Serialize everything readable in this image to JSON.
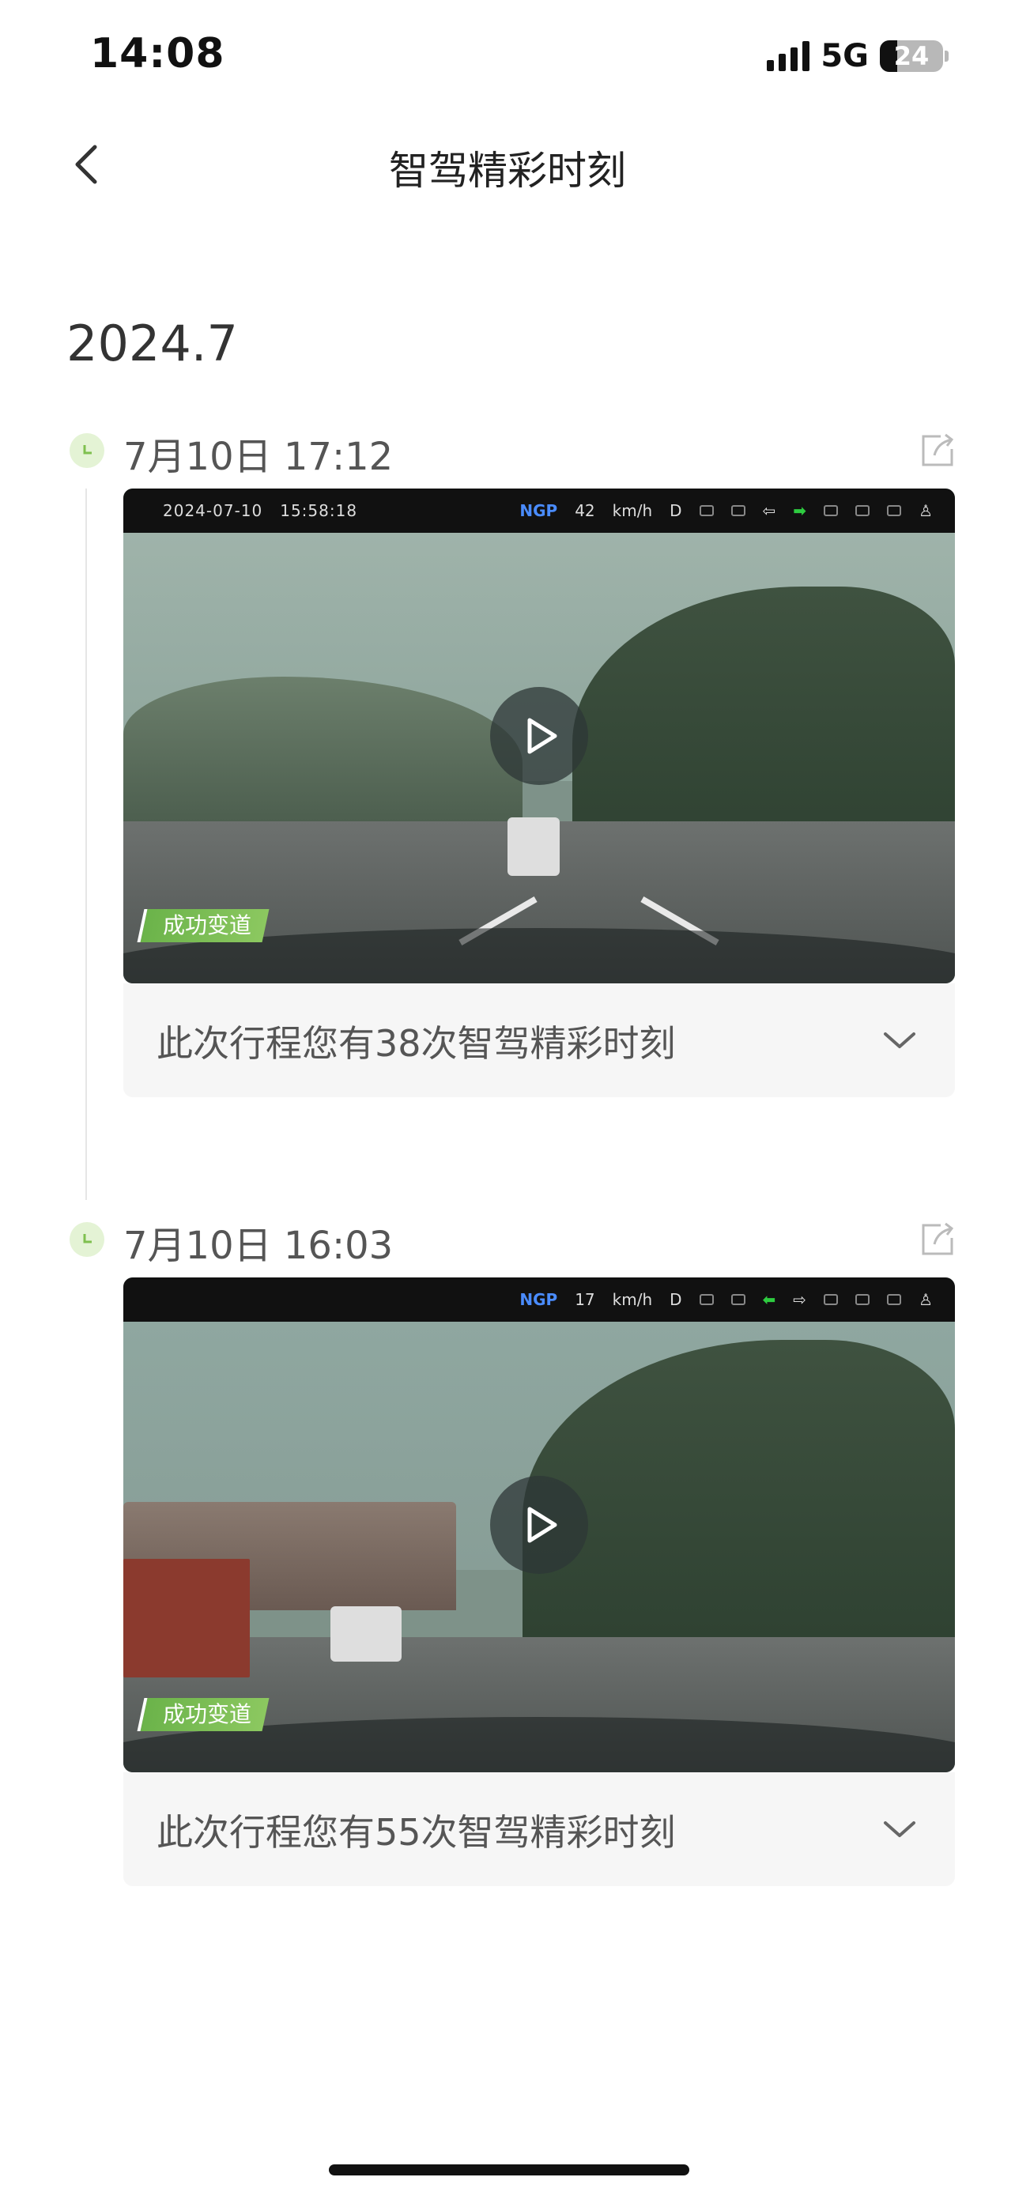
{
  "status_bar": {
    "time": "14:08",
    "network": "5G",
    "battery": "24"
  },
  "nav": {
    "title": "智驾精彩时刻"
  },
  "month": "2024.7",
  "entries": [
    {
      "time": "7月10日 17:12",
      "video": {
        "hud_date": "2024-07-10",
        "hud_clock": "15:58:18",
        "hud_mode": "NGP",
        "hud_speed": "42",
        "hud_unit": "km/h",
        "hud_gear": "D",
        "tag": "成功变道"
      },
      "summary": "此次行程您有38次智驾精彩时刻"
    },
    {
      "time": "7月10日 16:03",
      "video": {
        "hud_mode": "NGP",
        "hud_speed": "17",
        "hud_unit": "km/h",
        "hud_gear": "D",
        "tag": "成功变道"
      },
      "summary": "此次行程您有55次智驾精彩时刻"
    }
  ]
}
